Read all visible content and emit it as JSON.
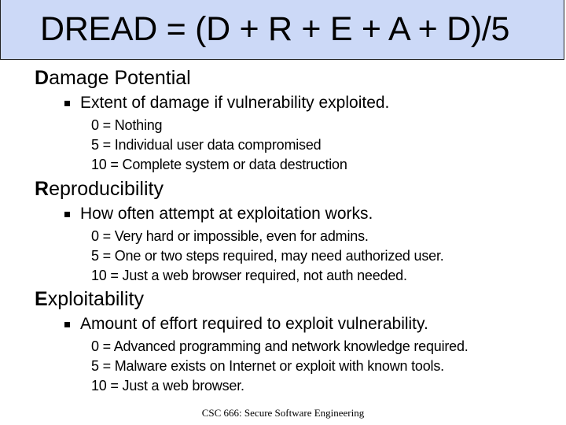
{
  "title": "DREAD = (D + R + E + A + D)/5",
  "sections": [
    {
      "initial": "D",
      "rest": "amage Potential",
      "bullet": "Extent of damage if vulnerability exploited.",
      "scores": [
        "0 = Nothing",
        "5 = Individual user data compromised",
        "10 = Complete system or data destruction"
      ]
    },
    {
      "initial": "R",
      "rest": "eproducibility",
      "bullet": "How often attempt at exploitation works.",
      "scores": [
        "0 = Very hard or impossible, even for admins.",
        "5 = One or two steps required, may need authorized user.",
        "10 = Just a web browser required, not auth needed."
      ]
    },
    {
      "initial": "E",
      "rest": "xploitability",
      "bullet": "Amount of effort required to exploit vulnerability.",
      "scores": [
        "0 = Advanced programming and network knowledge required.",
        "5 = Malware exists on Internet or exploit with known tools.",
        "10 = Just a web browser."
      ]
    }
  ],
  "footer": "CSC 666: Secure Software Engineering",
  "colors": {
    "title_background": "#ccd9f7",
    "title_border": "#222222",
    "text": "#000000"
  }
}
